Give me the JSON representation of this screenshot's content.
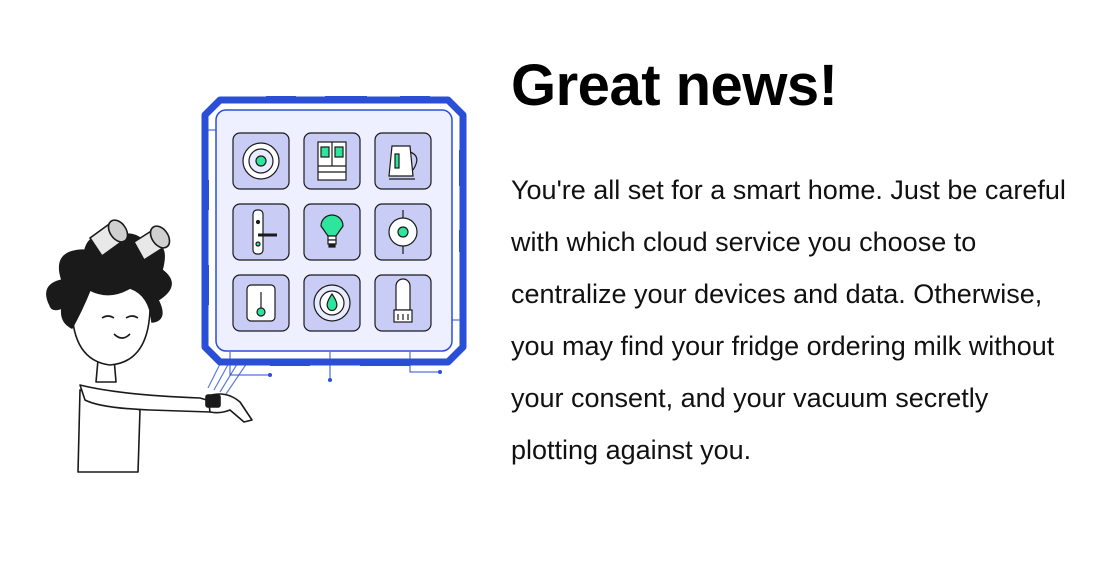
{
  "heading": "Great news!",
  "message": "You're all set for a smart home. Just be careful with which cloud service you choose to centralize your devices and data. Otherwise, you may find your fridge ordering milk without your consent, and your vacuum secretly plotting against you.",
  "illustration": {
    "devices": [
      {
        "icon": "robot-vacuum-icon"
      },
      {
        "icon": "smart-fridge-icon"
      },
      {
        "icon": "smart-kettle-icon"
      },
      {
        "icon": "smart-lock-icon"
      },
      {
        "icon": "smart-bulb-icon"
      },
      {
        "icon": "smart-plug-icon"
      },
      {
        "icon": "thermostat-icon"
      },
      {
        "icon": "water-sensor-icon"
      },
      {
        "icon": "air-purifier-icon"
      }
    ],
    "colors": {
      "frame_blue": "#2a4fd6",
      "panel_bg": "#e9ebff",
      "tile_bg": "#c9ccf4",
      "accent_green": "#2ee59d"
    }
  }
}
